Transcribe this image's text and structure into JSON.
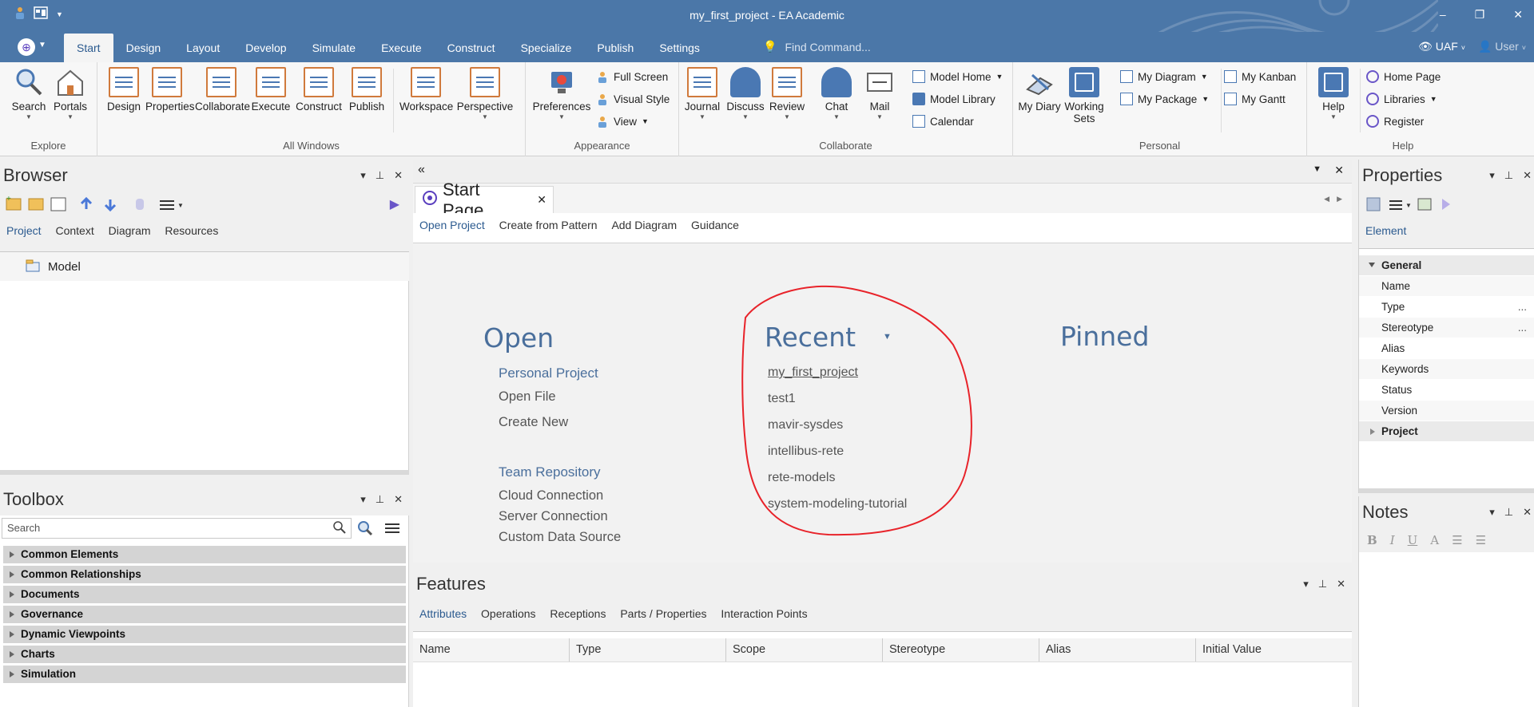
{
  "window": {
    "title": "my_first_project - EA Academic",
    "controls": {
      "minimize": "–",
      "restore": "❐",
      "close": "✕"
    },
    "quick_access": [
      "person-icon",
      "window-layout-icon",
      "dropdown-icon"
    ]
  },
  "ribbon": {
    "tabs": [
      "Start",
      "Design",
      "Layout",
      "Develop",
      "Simulate",
      "Execute",
      "Construct",
      "Specialize",
      "Publish",
      "Settings"
    ],
    "active_tab": "Start",
    "find_placeholder": "Find Command...",
    "perspective": "UAF",
    "user": "User",
    "groups": {
      "explore": {
        "label": "Explore",
        "buttons": [
          "Search",
          "Portals"
        ]
      },
      "all_windows": {
        "label": "All Windows",
        "buttons": [
          "Design",
          "Properties",
          "Collaborate",
          "Execute",
          "Construct",
          "Publish",
          "Workspace",
          "Perspective"
        ]
      },
      "appearance": {
        "label": "Appearance",
        "big": "Preferences",
        "small": [
          "Full Screen",
          "Visual Style",
          "View"
        ]
      },
      "collaborate": {
        "label": "Collaborate",
        "buttons": [
          "Journal",
          "Discuss",
          "Review",
          "Chat",
          "Mail"
        ],
        "small": [
          "Model Home",
          "Model Library",
          "Calendar"
        ]
      },
      "personal": {
        "label": "Personal",
        "buttons": [
          "My Diary",
          "Working Sets"
        ],
        "small": [
          "My Diagram",
          "My Package",
          "My Kanban",
          "My Gantt"
        ]
      },
      "help": {
        "label": "Help",
        "big": "Help",
        "small": [
          "Home Page",
          "Libraries",
          "Register"
        ]
      }
    }
  },
  "browser": {
    "title": "Browser",
    "tabs": [
      "Project",
      "Context",
      "Diagram",
      "Resources"
    ],
    "active_tab": "Project",
    "tree": [
      "Model"
    ]
  },
  "toolbox": {
    "title": "Toolbox",
    "search_placeholder": "Search",
    "categories": [
      "Common Elements",
      "Common Relationships",
      "Documents",
      "Governance",
      "Dynamic Viewpoints",
      "Charts",
      "Simulation"
    ]
  },
  "start_page": {
    "tab_label": "Start Page",
    "links": [
      "Open Project",
      "Create from Pattern",
      "Add Diagram",
      "Guidance"
    ],
    "active_link": "Open Project",
    "open": {
      "heading": "Open",
      "personal_heading": "Personal Project",
      "personal_items": [
        "Open File",
        "Create New"
      ],
      "team_heading": "Team Repository",
      "team_items": [
        "Cloud Connection",
        "Server Connection",
        "Custom Data Source"
      ]
    },
    "recent": {
      "heading": "Recent",
      "items": [
        "my_first_project",
        "test1",
        "mavir-sysdes",
        "intellibus-rete",
        "rete-models",
        "system-modeling-tutorial"
      ],
      "highlight_color": "#e8232a"
    },
    "pinned": {
      "heading": "Pinned"
    }
  },
  "features": {
    "title": "Features",
    "tabs": [
      "Attributes",
      "Operations",
      "Receptions",
      "Parts / Properties",
      "Interaction Points"
    ],
    "active_tab": "Attributes",
    "columns": [
      "Name",
      "Type",
      "Scope",
      "Stereotype",
      "Alias",
      "Initial Value"
    ]
  },
  "properties": {
    "title": "Properties",
    "tab": "Element",
    "group_general": "General",
    "fields": [
      {
        "name": "Name",
        "ellipsis": ""
      },
      {
        "name": "Type",
        "ellipsis": "..."
      },
      {
        "name": "Stereotype",
        "ellipsis": "..."
      },
      {
        "name": "Alias",
        "ellipsis": ""
      },
      {
        "name": "Keywords",
        "ellipsis": ""
      },
      {
        "name": "Status",
        "ellipsis": ""
      },
      {
        "name": "Version",
        "ellipsis": ""
      }
    ],
    "group_project": "Project"
  },
  "notes": {
    "title": "Notes",
    "format_buttons": [
      "B",
      "I",
      "U"
    ]
  },
  "colors": {
    "titlebar": "#4b77a8",
    "heading_blue": "#4a6f9c",
    "active_tab_text": "#2b5a8f"
  }
}
